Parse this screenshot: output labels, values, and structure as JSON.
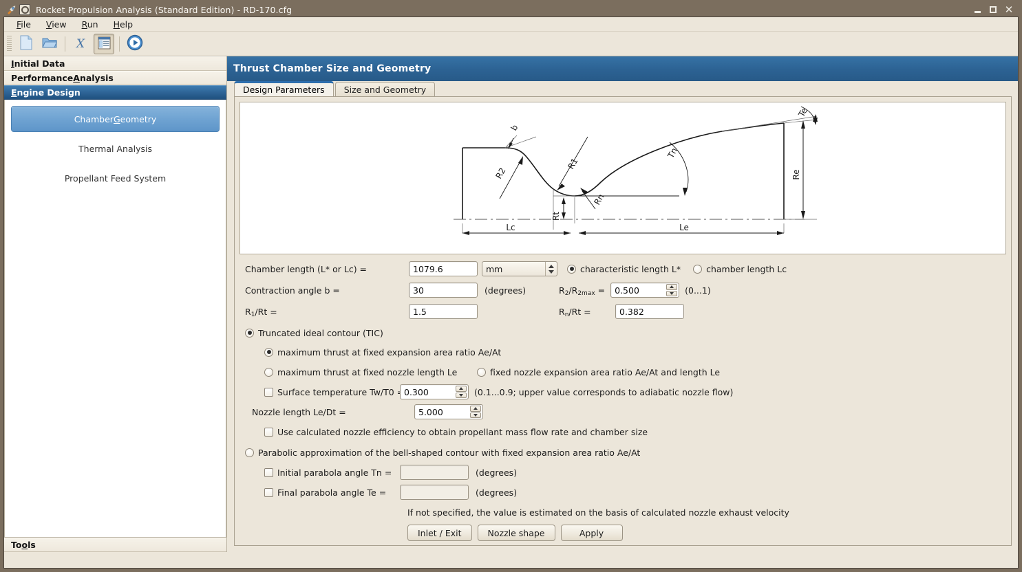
{
  "window": {
    "title": "Rocket Propulsion Analysis (Standard Edition) - RD-170.cfg",
    "app_icon": "rocket-icon",
    "menu_icon": "window-menu-icon",
    "minimize_label": "Minimize",
    "maximize_label": "Maximize",
    "close_label": "Close"
  },
  "menubar": {
    "items": [
      {
        "label": "File",
        "mnemonic": "F",
        "rest": "ile"
      },
      {
        "label": "View",
        "mnemonic": "V",
        "rest": "iew"
      },
      {
        "label": "Run",
        "mnemonic": "R",
        "rest": "un"
      },
      {
        "label": "Help",
        "mnemonic": "H",
        "rest": "elp"
      }
    ]
  },
  "toolbar": {
    "buttons": [
      {
        "name": "new-file-icon",
        "tooltip": "New"
      },
      {
        "name": "open-folder-icon",
        "tooltip": "Open"
      },
      {
        "name": "export-x-icon",
        "tooltip": "X",
        "glyph": "X"
      },
      {
        "name": "report-view-icon",
        "tooltip": "View",
        "pressed": true
      },
      {
        "name": "run-play-icon",
        "tooltip": "Run"
      }
    ]
  },
  "sidebar": {
    "sections": [
      {
        "label": "Initial Data",
        "mnemonic": "I",
        "rest": "nitial Data",
        "selected": false
      },
      {
        "label": "Performance Analysis",
        "pre": "Performance ",
        "mnemonic": "A",
        "rest": "nalysis",
        "selected": false
      },
      {
        "label": "Engine Design",
        "mnemonic": "E",
        "rest": "ngine Design",
        "selected": true
      }
    ],
    "nav_items": [
      {
        "label": "Chamber Geometry",
        "pre": "Chamber ",
        "mnemonic": "G",
        "rest": "eometry",
        "active": true
      },
      {
        "label": "Thermal Analysis",
        "active": false
      },
      {
        "label": "Propellant Feed System",
        "active": false
      }
    ],
    "bottom_section": {
      "pre": "To",
      "mnemonic": "o",
      "label": "Tools",
      "rest": "ls"
    }
  },
  "page": {
    "header_title": "Thrust Chamber Size and Geometry",
    "tabs": [
      {
        "label": "Design Parameters",
        "active": true
      },
      {
        "label": "Size and Geometry",
        "active": false
      }
    ]
  },
  "diagram": {
    "name": "nozzle-contour-diagram",
    "labels": {
      "contraction_angle": "b",
      "radius_r2": "R2",
      "radius_r1": "R1",
      "radius_rn": "Rn",
      "angle_tn": "Tn",
      "angle_te": "Te",
      "throat_radius": "Rt",
      "exit_radius": "Re",
      "chamber_length": "Lc",
      "nozzle_length": "Le"
    }
  },
  "form": {
    "chamber_length": {
      "label": "Chamber length (L* or Lc) =",
      "value": "1079.6",
      "unit": "mm",
      "radio_characteristic": "characteristic length L*",
      "radio_chamber": "chamber length Lc",
      "selected": "characteristic"
    },
    "contraction_angle": {
      "label": "Contraction angle b =",
      "value": "30",
      "units_note": "(degrees)"
    },
    "r2_ratio": {
      "label_pre": "R",
      "label_sub1": "2",
      "label_mid": "/R",
      "label_sub2": "2max",
      "label_post": " =",
      "label": "R2/R2max =",
      "value": "0.500",
      "range_note": "(0...1)"
    },
    "r1_rt": {
      "label_pre": "R",
      "label_sub": "1",
      "label_post": "/Rt =",
      "label": "R1/Rt =",
      "value": "1.5"
    },
    "rn_rt": {
      "label_pre": "R",
      "label_sub": "n",
      "label_post": "/Rt =",
      "label": "Rn/Rt =",
      "value": "0.382"
    },
    "tic": {
      "label": "Truncated ideal contour (TIC)",
      "selected": true,
      "options": [
        {
          "label": "maximum thrust at fixed expansion area ratio Ae/At",
          "selected": true
        },
        {
          "label": "maximum thrust at fixed nozzle length Le",
          "selected": false
        },
        {
          "label": "fixed nozzle expansion area ratio Ae/At and length Le",
          "selected": false
        }
      ]
    },
    "surface_temperature": {
      "label": "Surface temperature Tw/T0 =",
      "checked": false,
      "value": "0.300",
      "note": "(0.1...0.9; upper value corresponds to adiabatic nozzle flow)"
    },
    "nozzle_length": {
      "label": "Nozzle length Le/Dt =",
      "value": "5.000"
    },
    "use_calculated_efficiency": {
      "label": "Use calculated nozzle efficiency to obtain propellant mass flow rate and chamber size",
      "checked": false
    },
    "parabolic": {
      "label": "Parabolic approximation of the bell-shaped contour with fixed expansion area ratio Ae/At",
      "selected": false
    },
    "initial_parabola_angle": {
      "label": "Initial parabola angle Tn =",
      "checked": false,
      "value": "",
      "units_note": "(degrees)"
    },
    "final_parabola_angle": {
      "label": "Final parabola angle Te =",
      "checked": false,
      "value": "",
      "units_note": "(degrees)"
    },
    "hint": "If not specified, the value is estimated on the basis of calculated nozzle exhaust velocity",
    "buttons": [
      {
        "label": "Inlet / Exit",
        "name": "inlet-exit-button"
      },
      {
        "label": "Nozzle shape",
        "name": "nozzle-shape-button"
      },
      {
        "label": "Apply",
        "name": "apply-button"
      }
    ]
  },
  "colors": {
    "title_bar": "#7b6e5e",
    "header_blue": "#2c6293",
    "accent_blue": "#2e6fae",
    "panel_bg": "#ece6da",
    "selected_nav": "#6fa3d2"
  }
}
